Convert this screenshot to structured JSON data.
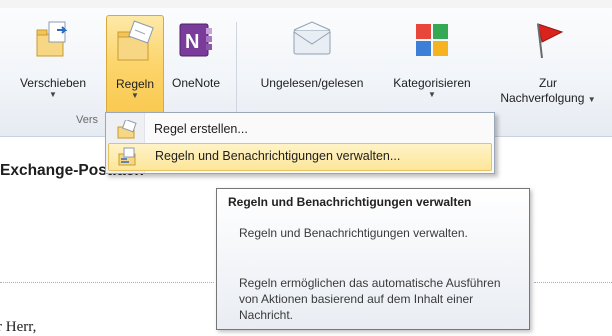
{
  "ribbon": {
    "buttons": {
      "verschieben": "Verschieben",
      "regeln": "Regeln",
      "onenote": "OneNote",
      "ungelesen": "Ungelesen/gelesen",
      "kategorisieren": "Kategorisieren",
      "zur": "Zur",
      "nachverfolgung": "Nachverfolgung"
    },
    "group_label": "Vers"
  },
  "menu": {
    "items": [
      {
        "label": "Regel erstellen...",
        "icon": "create-rule-icon"
      },
      {
        "label": "Regeln und Benachrichtigungen verwalten...",
        "icon": "manage-rules-icon"
      }
    ]
  },
  "heading": "Exchange-Postfach",
  "tooltip": {
    "title": "Regeln und Benachrichtigungen verwalten",
    "line1": "Regeln und Benachrichtigungen verwalten.",
    "line2": "Regeln ermöglichen das automatische Ausführen von Aktionen basierend auf dem Inhalt einer Nachricht."
  },
  "body": {
    "salutation": "r Herr,"
  },
  "colors": {
    "highlight": "#fcd56d",
    "menu_hot": "#fde69a",
    "flag_red": "#d8241c"
  }
}
